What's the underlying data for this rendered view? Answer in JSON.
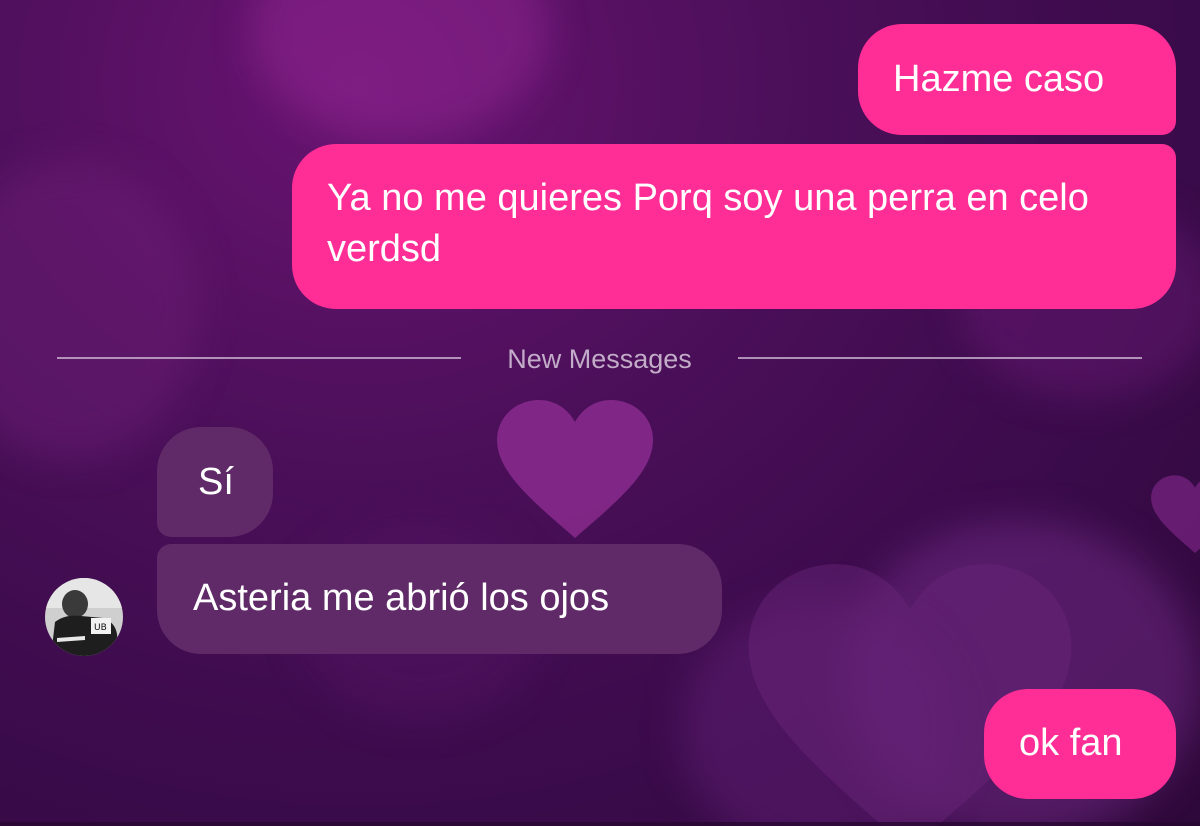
{
  "chat": {
    "messages": [
      {
        "text": "Hazme caso",
        "direction": "outgoing"
      },
      {
        "text": "Ya no me quieres Porq soy una perra en celo verdsd",
        "direction": "outgoing"
      },
      {
        "text": "Sí",
        "direction": "incoming"
      },
      {
        "text": "Asteria me abrió los ojos",
        "direction": "incoming"
      },
      {
        "text": "ok fan",
        "direction": "outgoing"
      }
    ],
    "divider_label": "New Messages"
  },
  "theme": {
    "outgoing_bubble_color": "#ff2d96",
    "incoming_bubble_color": "#5f2a67",
    "background": "purple hearts wallpaper"
  },
  "icons": {
    "avatar": "contact-avatar-photo"
  }
}
